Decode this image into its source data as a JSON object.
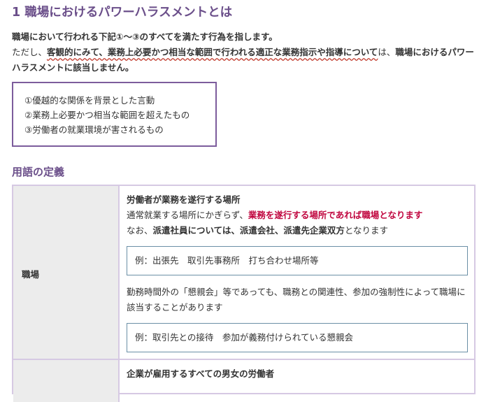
{
  "section": {
    "title": "1 職場におけるパワーハラスメントとは"
  },
  "intro": {
    "line1": "職場において行われる下記①～③のすべてを満たす行為を指します。",
    "line2_pre": "ただし、",
    "line2_wavy": "客観的にみて、業務上必要かつ相当な範囲で行われる適正な業務指示や指導について",
    "line2_mid": "は、",
    "line2_bold": "職場におけるパワーハラスメントに該当しません。"
  },
  "criteria": [
    "①優越的な関係を背景とした言動",
    "②業務上必要かつ相当な範囲を超えたもの",
    "③労働者の就業環境が害されるもの"
  ],
  "definitions": {
    "title": "用語の定義",
    "rows": [
      {
        "term": "職場",
        "heading": "労働者が業務を遂行する場所",
        "line2_pre": "通常就業する場所にかぎらず、",
        "line2_red": "業務を遂行する場所であれば職場となります",
        "line3_pre": "なお、",
        "line3_bold": "派遣社員については、派遣会社、派遣先企業双方",
        "line3_post": "となります",
        "example1": "例：出張先　取引先事務所　打ち合わせ場所等",
        "note": "勤務時間外の「懇親会」等であっても、職務との関連性、参加の強制性によって職場に該当することがあります",
        "example2": "例：取引先との接待　参加が義務付けられている懇親会"
      },
      {
        "term": "",
        "heading": "企業が雇用するすべての男女の労働者"
      }
    ]
  }
}
